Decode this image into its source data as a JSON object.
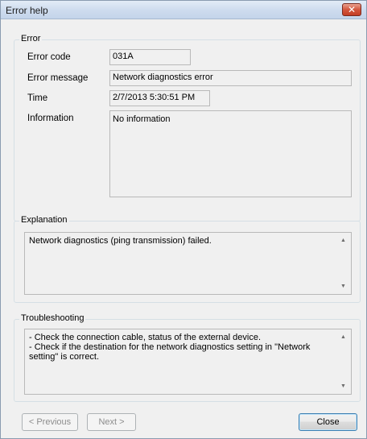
{
  "window": {
    "title": "Error help",
    "close_glyph": "✕"
  },
  "error_group": {
    "title": "Error",
    "code_label": "Error code",
    "code_value": "031A",
    "message_label": "Error message",
    "message_value": "Network diagnostics error",
    "time_label": "Time",
    "time_value": "2/7/2013 5:30:51 PM",
    "info_label": "Information",
    "info_value": "No information"
  },
  "explanation_group": {
    "title": "Explanation",
    "text": "Network diagnostics (ping transmission) failed."
  },
  "troubleshooting_group": {
    "title": "Troubleshooting",
    "line1": "- Check the connection cable, status of the external device.",
    "line2": "- Check if the destination for the network diagnostics setting in \"Network",
    "line3": "setting\" is correct."
  },
  "buttons": {
    "previous": "< Previous",
    "next": "Next >",
    "close": "Close"
  },
  "icons": {
    "scroll_up": "▲",
    "scroll_down": "▼"
  }
}
